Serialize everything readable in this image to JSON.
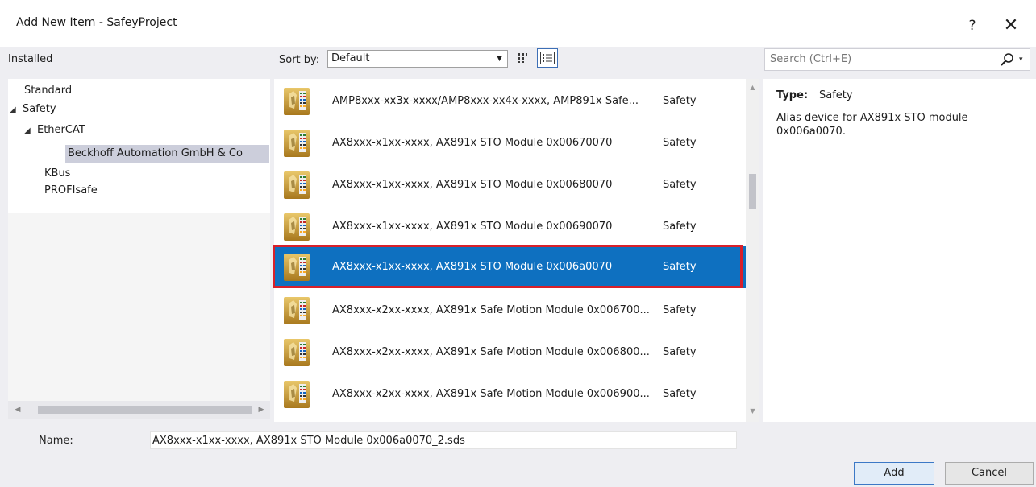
{
  "window": {
    "title": "Add New Item - SafeyProject",
    "help_label": "?",
    "close_label": "✕"
  },
  "tree": {
    "header": "Installed",
    "nodes": [
      {
        "label": "Standard",
        "expander": ""
      },
      {
        "label": "Safety",
        "expander": "◢"
      },
      {
        "label": "EtherCAT",
        "expander": "◢"
      },
      {
        "label": "Beckhoff Automation GmbH & Co",
        "expander": ""
      },
      {
        "label": "KBus",
        "expander": ""
      },
      {
        "label": "PROFIsafe",
        "expander": ""
      }
    ],
    "scroll_left": "◀",
    "scroll_right": "▶"
  },
  "sort": {
    "label": "Sort by:",
    "value": "Default",
    "arrow": "▼",
    "grid_view_icon": "grid-view-icon",
    "list_view_icon": "list-view-icon"
  },
  "items": [
    {
      "name": "AMP8xxx-xx3x-xxxx/AMP8xxx-xx4x-xxxx, AMP891x Safe...",
      "category": "Safety",
      "selected": false
    },
    {
      "name": "AX8xxx-x1xx-xxxx, AX891x STO Module 0x00670070",
      "category": "Safety",
      "selected": false
    },
    {
      "name": "AX8xxx-x1xx-xxxx, AX891x STO Module 0x00680070",
      "category": "Safety",
      "selected": false
    },
    {
      "name": "AX8xxx-x1xx-xxxx, AX891x STO Module 0x00690070",
      "category": "Safety",
      "selected": false
    },
    {
      "name": "AX8xxx-x1xx-xxxx, AX891x STO Module 0x006a0070",
      "category": "Safety",
      "selected": true
    },
    {
      "name": "AX8xxx-x2xx-xxxx, AX891x Safe Motion Module 0x006700...",
      "category": "Safety",
      "selected": false
    },
    {
      "name": "AX8xxx-x2xx-xxxx, AX891x Safe Motion Module 0x006800...",
      "category": "Safety",
      "selected": false
    },
    {
      "name": "AX8xxx-x2xx-xxxx, AX891x Safe Motion Module 0x006900...",
      "category": "Safety",
      "selected": false
    }
  ],
  "list_scroll": {
    "up": "▲",
    "down": "▼"
  },
  "search": {
    "placeholder": "Search (Ctrl+E)",
    "dropdown": "▾"
  },
  "details": {
    "type_label": "Type:",
    "type_value": "Safety",
    "description": "Alias device for AX891x STO module 0x006a0070."
  },
  "footer": {
    "name_label": "Name:",
    "name_value": "AX8xxx-x1xx-xxxx, AX891x STO Module 0x006a0070_2.sds",
    "add_label": "Add",
    "cancel_label": "Cancel"
  },
  "colors": {
    "selection": "#0e70c0",
    "highlight_outline": "#d8202a",
    "tree_selection": "#cccedb"
  }
}
